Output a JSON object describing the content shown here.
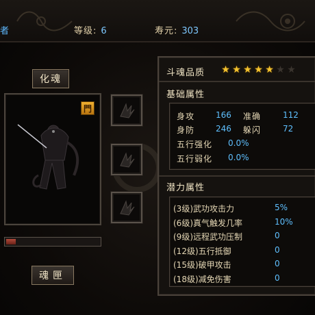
{
  "header": {
    "name_fragment": "者",
    "level_label": "等级:",
    "level_value": "6",
    "lifespan_label": "寿元:",
    "lifespan_value": "303"
  },
  "left_panel": {
    "huahun_button": "化魂",
    "clan_badge": "門",
    "hunxia_button": "魂匣",
    "progress_fraction": 0.1,
    "slot_icons": [
      "skill-slot-icon-1",
      "skill-slot-icon-2",
      "skill-slot-icon-3"
    ]
  },
  "quality": {
    "label": "斗魂品质",
    "stars_filled": 5,
    "stars_total": 7
  },
  "basic": {
    "title": "基础属性",
    "attack_label": "身攻",
    "attack_value": "166",
    "accuracy_label": "准确",
    "accuracy_value": "112",
    "defense_label": "身防",
    "defense_value": "246",
    "dodge_label": "躲闪",
    "dodge_value": "72",
    "wuxing_strengthen_label": "五行强化",
    "wuxing_strengthen_value": "0.0%",
    "wuxing_weaken_label": "五行弱化",
    "wuxing_weaken_value": "0.0%"
  },
  "potential": {
    "title": "潜力属性",
    "items": [
      {
        "label": "(3级)武功攻击力",
        "value": "5%"
      },
      {
        "label": "(6级)真气触发几率",
        "value": "10%"
      },
      {
        "label": "(9级)远程武功压制",
        "value": "0"
      },
      {
        "label": "(12级)五行抵御",
        "value": "0"
      },
      {
        "label": "(15级)破甲攻击",
        "value": "0"
      },
      {
        "label": "(18级)减免伤害",
        "value": "0"
      }
    ]
  },
  "colors": {
    "accent_blue": "#5fc0ff",
    "star_gold": "#f4c430",
    "badge_orange": "#e8a020"
  }
}
